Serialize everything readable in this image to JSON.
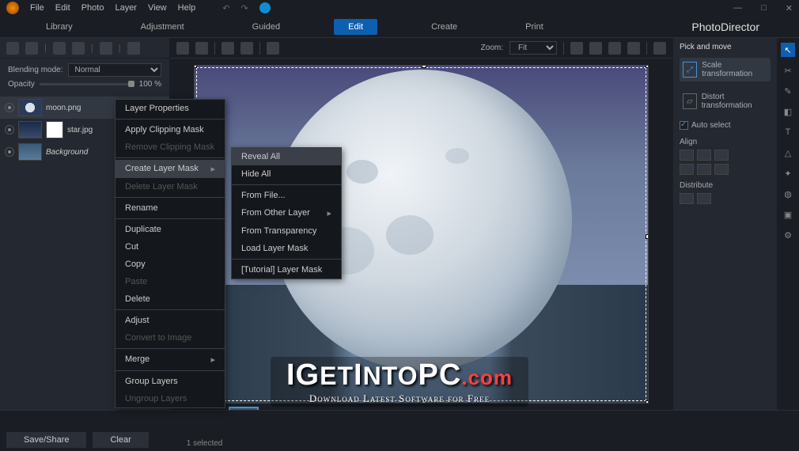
{
  "menubar": {
    "items": [
      "File",
      "Edit",
      "Photo",
      "Layer",
      "View",
      "Help"
    ]
  },
  "modebar": {
    "tabs": [
      "Library",
      "Adjustment",
      "Guided",
      "Edit",
      "Create",
      "Print"
    ],
    "active": "Edit",
    "brand": "PhotoDirector"
  },
  "blending": {
    "label": "Blending mode:",
    "value": "Normal"
  },
  "opacity": {
    "label": "Opacity",
    "value": "100 %"
  },
  "layers": [
    {
      "name": "moon.png",
      "selected": true,
      "thumb": "moon"
    },
    {
      "name": "star.jpg",
      "selected": false,
      "thumb": "star",
      "mask": true
    },
    {
      "name": "Background",
      "selected": false,
      "thumb": "bg",
      "italic": true
    }
  ],
  "zoom": {
    "label": "Zoom:",
    "value": "Fit"
  },
  "rightpanel": {
    "title": "Pick and move",
    "scale": "Scale transformation",
    "distort": "Distort transformation",
    "autoselect": "Auto select",
    "align": "Align",
    "distribute": "Distribute"
  },
  "context_menu_1": [
    {
      "label": "Layer Properties",
      "enabled": true
    },
    {
      "sep": true
    },
    {
      "label": "Apply Clipping Mask",
      "enabled": true
    },
    {
      "label": "Remove Clipping Mask",
      "enabled": false
    },
    {
      "sep": true
    },
    {
      "label": "Create Layer Mask",
      "enabled": true,
      "submenu": true,
      "hover": true
    },
    {
      "label": "Delete Layer Mask",
      "enabled": false
    },
    {
      "sep": true
    },
    {
      "label": "Rename",
      "enabled": true
    },
    {
      "sep": true
    },
    {
      "label": "Duplicate",
      "enabled": true
    },
    {
      "label": "Cut",
      "enabled": true
    },
    {
      "label": "Copy",
      "enabled": true
    },
    {
      "label": "Paste",
      "enabled": false
    },
    {
      "label": "Delete",
      "enabled": true
    },
    {
      "sep": true
    },
    {
      "label": "Adjust",
      "enabled": true
    },
    {
      "label": "Convert to Image",
      "enabled": false
    },
    {
      "sep": true
    },
    {
      "label": "Merge",
      "enabled": true,
      "submenu": true
    },
    {
      "sep": true
    },
    {
      "label": "Group Layers",
      "enabled": true
    },
    {
      "label": "Ungroup Layers",
      "enabled": false
    }
  ],
  "context_menu_2": [
    {
      "label": "Reveal All",
      "enabled": true,
      "hover": true
    },
    {
      "label": "Hide All",
      "enabled": true
    },
    {
      "sep": true
    },
    {
      "label": "From File...",
      "enabled": true
    },
    {
      "label": "From Other Layer",
      "enabled": true,
      "submenu": true
    },
    {
      "label": "From Transparency",
      "enabled": true
    },
    {
      "label": "Load Layer Mask",
      "enabled": true
    },
    {
      "sep": true
    },
    {
      "label": "[Tutorial] Layer Mask",
      "enabled": true
    }
  ],
  "bottom": {
    "save": "Save/Share",
    "clear": "Clear",
    "status": "1 selected"
  },
  "watermark": {
    "line1_parts": [
      "I",
      "G",
      "ET",
      "I",
      "NTO",
      "PC",
      ".com"
    ],
    "line2": "Download Latest Software for Free"
  }
}
